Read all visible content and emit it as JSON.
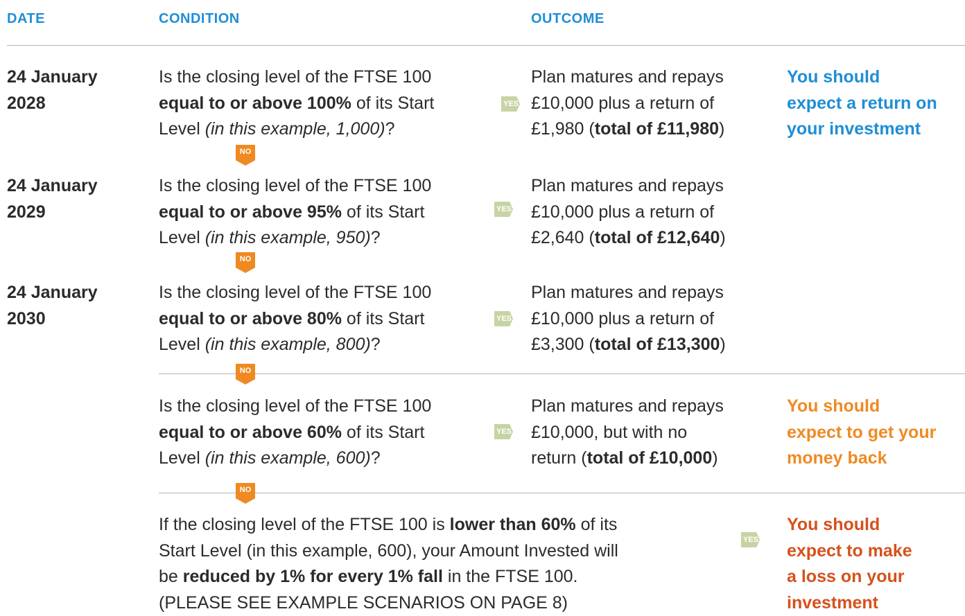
{
  "headers": {
    "date": "DATE",
    "condition": "CONDITION",
    "outcome": "OUTCOME"
  },
  "badges": {
    "yes": "YES",
    "no": "NO"
  },
  "rows": [
    {
      "date_day": "24 January",
      "date_year": "2028",
      "cond": {
        "l1": "Is the closing level of the FTSE 100",
        "l2b": "equal to or above 100%",
        "l2r": " of its Start",
        "l3a": "Level ",
        "l3i": "(in this example, 1,000)",
        "l3q": "?"
      },
      "out": {
        "l1": "Plan matures and repays",
        "l2": "£10,000 plus a return of",
        "l3a": "£1,980 (",
        "l3b": "total of £11,980",
        "l3c": ")"
      }
    },
    {
      "date_day": "24 January",
      "date_year": "2029",
      "cond": {
        "l1": "Is the closing level of the FTSE 100",
        "l2b": "equal to or above 95%",
        "l2r": " of its Start",
        "l3a": "Level ",
        "l3i": "(in this example, 950)",
        "l3q": "?"
      },
      "out": {
        "l1": "Plan matures and repays",
        "l2": "£10,000 plus a return of",
        "l3a": "£2,640 (",
        "l3b": "total of £12,640",
        "l3c": ")"
      }
    },
    {
      "date_day": "24 January",
      "date_year": "2030",
      "cond": {
        "l1": "Is the closing level of the FTSE 100",
        "l2b": "equal to or above 80%",
        "l2r": " of its Start",
        "l3a": "Level ",
        "l3i": "(in this example, 800)",
        "l3q": "?"
      },
      "out": {
        "l1": "Plan matures and repays",
        "l2": "£10,000 plus a return of",
        "l3a": "£3,300 (",
        "l3b": "total of £13,300",
        "l3c": ")"
      }
    },
    {
      "cond": {
        "l1": "Is the closing level of the FTSE 100",
        "l2b": "equal to or above 60%",
        "l2r": " of its Start",
        "l3a": "Level ",
        "l3i": "(in this example, 600)",
        "l3q": "?"
      },
      "out": {
        "l1": "Plan matures and repays",
        "l2": "£10,000, but with no",
        "l3a": "return (",
        "l3b": "total of £10,000",
        "l3c": ")"
      }
    }
  ],
  "final": {
    "l1a": "If the closing level of the FTSE 100 is ",
    "l1b": "lower than 60%",
    "l1c": " of its",
    "l2": "Start Level (in this example, 600), your Amount Invested will",
    "l3a": "be ",
    "l3b": "reduced by 1% for every 1% fall",
    "l3c": " in the FTSE 100.",
    "l4": "(PLEASE SEE EXAMPLE SCENARIOS ON PAGE 8)"
  },
  "results": {
    "return": {
      "l1": "You should",
      "l2": "expect a return on",
      "l3": "your investment",
      "color": "#1f8ed6"
    },
    "money_back": {
      "l1": "You should",
      "l2": "expect to get your",
      "l3": "money back",
      "color": "#ef8a22"
    },
    "loss": {
      "l1": "You should",
      "l2": "expect to make",
      "l3": "a loss on your",
      "l4": "investment",
      "color": "#d5521c"
    }
  }
}
